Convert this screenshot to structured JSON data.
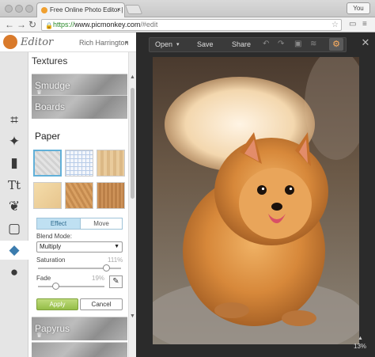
{
  "browser": {
    "tab_title": "Free Online Photo Editor |",
    "tab_close": "×",
    "profile": "You",
    "url_host": "www.picmonkey.com",
    "url_path": "/#edit",
    "url_scheme": "https://"
  },
  "editor": {
    "logo": "Editor",
    "user": "Rich Harrington",
    "user_caret": "▾"
  },
  "rail_icons": [
    "crop-icon",
    "magic-wand-icon",
    "touchup-icon",
    "text-icon",
    "butterfly-icon",
    "frame-icon",
    "textures-icon",
    "themes-icon"
  ],
  "panel": {
    "section_title": "Textures",
    "textures_above": [
      "Smudge",
      "Boards"
    ],
    "active_texture": "Paper",
    "textures_below": [
      "Papyrus"
    ],
    "thumb_colors": [
      "#dcdcdc",
      "#eef3fb",
      "#e8c99a",
      "#efd7a6",
      "#d49a5a",
      "#c88e54"
    ],
    "segments": {
      "effect": "Effect",
      "move": "Move"
    },
    "blend_mode_label": "Blend Mode:",
    "blend_mode_value": "Multiply",
    "saturation_label": "Saturation",
    "saturation_value": "111%",
    "saturation_level": 0.82,
    "fade_label": "Fade",
    "fade_value": "19%",
    "fade_level": 0.19,
    "apply": "Apply",
    "cancel": "Cancel"
  },
  "toolbar": {
    "open": "Open",
    "open_caret": "▾",
    "save": "Save",
    "share": "Share",
    "close": "✕",
    "zoom": "13%"
  },
  "colors": {
    "accent_blue": "#3b7cae",
    "apply_green": "#94bd47",
    "dark_canvas": "#2b2b2b"
  }
}
